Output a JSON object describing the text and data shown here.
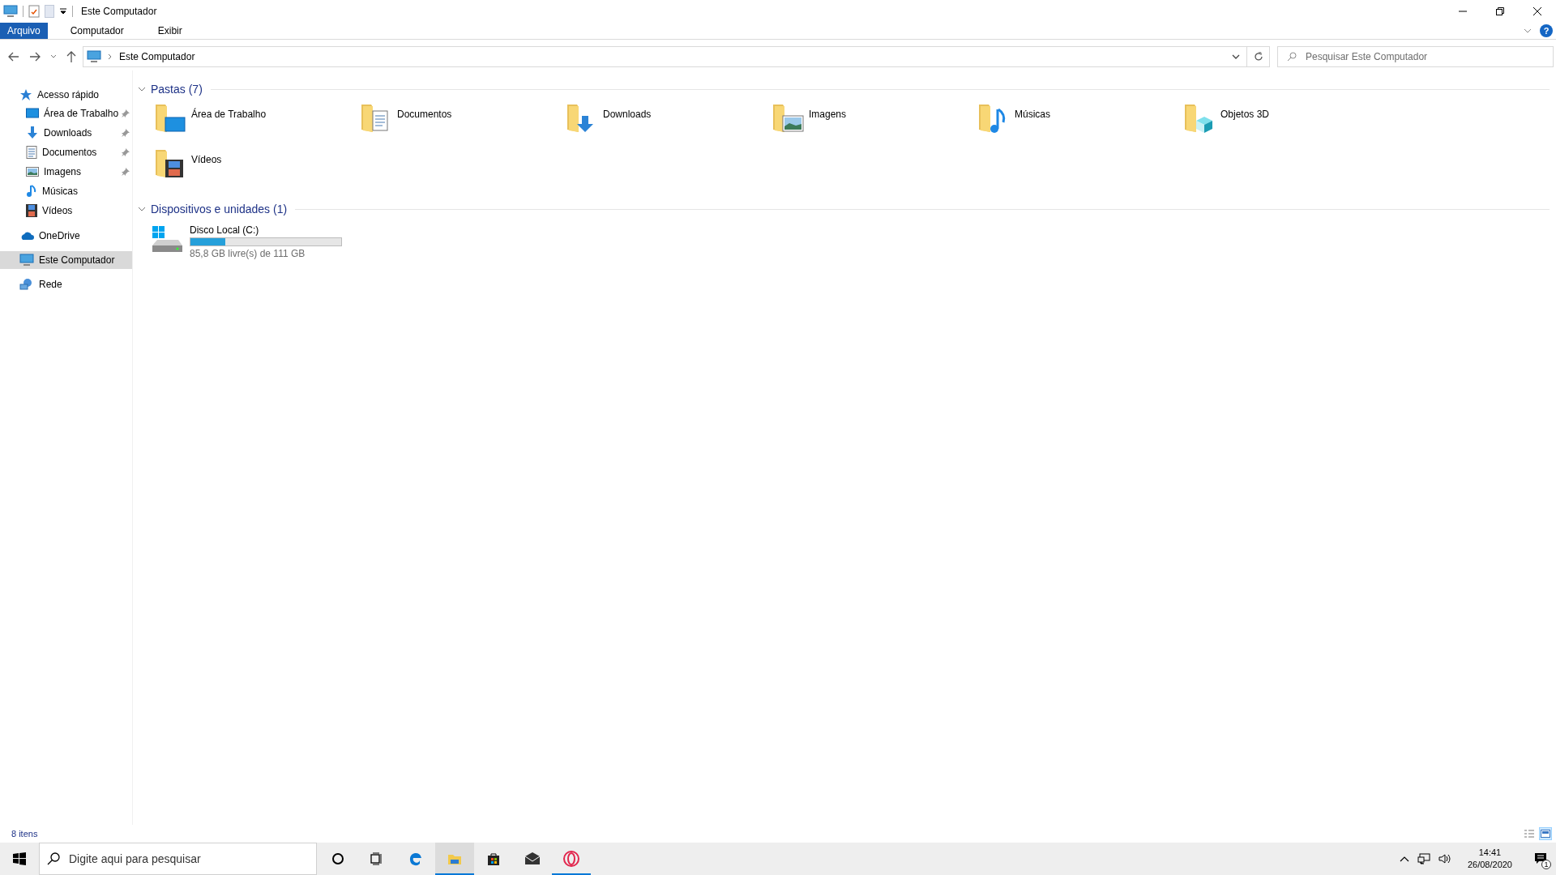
{
  "window": {
    "title": "Este Computador"
  },
  "ribbon_tabs": [
    {
      "label": "Arquivo",
      "selected": true
    },
    {
      "label": "Computador",
      "selected": false
    },
    {
      "label": "Exibir",
      "selected": false
    }
  ],
  "help_button": "?",
  "address_bar": {
    "path": [
      "Este Computador"
    ]
  },
  "search": {
    "placeholder": "Pesquisar Este Computador"
  },
  "sidebar": {
    "items": [
      {
        "label": "Acesso rápido",
        "selected": false,
        "children": [
          {
            "label": "Área de Trabalho",
            "pinned": true,
            "selected": false
          },
          {
            "label": "Downloads",
            "pinned": true,
            "selected": false
          },
          {
            "label": "Documentos",
            "pinned": true,
            "selected": false
          },
          {
            "label": "Imagens",
            "pinned": true,
            "selected": false
          },
          {
            "label": "Músicas",
            "pinned": false,
            "selected": false
          },
          {
            "label": "Vídeos",
            "pinned": false,
            "selected": false
          }
        ]
      },
      {
        "label": "OneDrive",
        "selected": false
      },
      {
        "label": "Este Computador",
        "selected": true
      },
      {
        "label": "Rede",
        "selected": false
      }
    ]
  },
  "sections": [
    {
      "title": "Pastas (7)",
      "expanded": true,
      "kind": "folders",
      "items": [
        {
          "label": "Área de Trabalho"
        },
        {
          "label": "Documentos"
        },
        {
          "label": "Downloads"
        },
        {
          "label": "Imagens"
        },
        {
          "label": "Músicas"
        },
        {
          "label": "Objetos 3D"
        },
        {
          "label": "Vídeos"
        }
      ]
    },
    {
      "title": "Dispositivos e unidades (1)",
      "expanded": true,
      "kind": "drives",
      "items": [
        {
          "label": "Disco Local (C:)",
          "level": 0.23,
          "info": "85,8 GB livre(s) de 111 GB"
        }
      ]
    }
  ],
  "status_bar": {
    "count": "8 itens",
    "view_modes": [
      {
        "selected": false
      },
      {
        "selected": true
      }
    ]
  },
  "taskbar": {
    "search_placeholder": "Digite aqui para pesquisar",
    "apps": [
      {
        "running": false,
        "selected": false
      },
      {
        "running": false,
        "selected": false
      },
      {
        "running": false,
        "selected": false
      },
      {
        "running": true,
        "selected": true
      },
      {
        "running": false,
        "selected": false
      },
      {
        "running": false,
        "selected": false
      },
      {
        "running": true,
        "selected": false
      }
    ],
    "time": "14:41",
    "date": "26/08/2020",
    "notifications": "1"
  }
}
